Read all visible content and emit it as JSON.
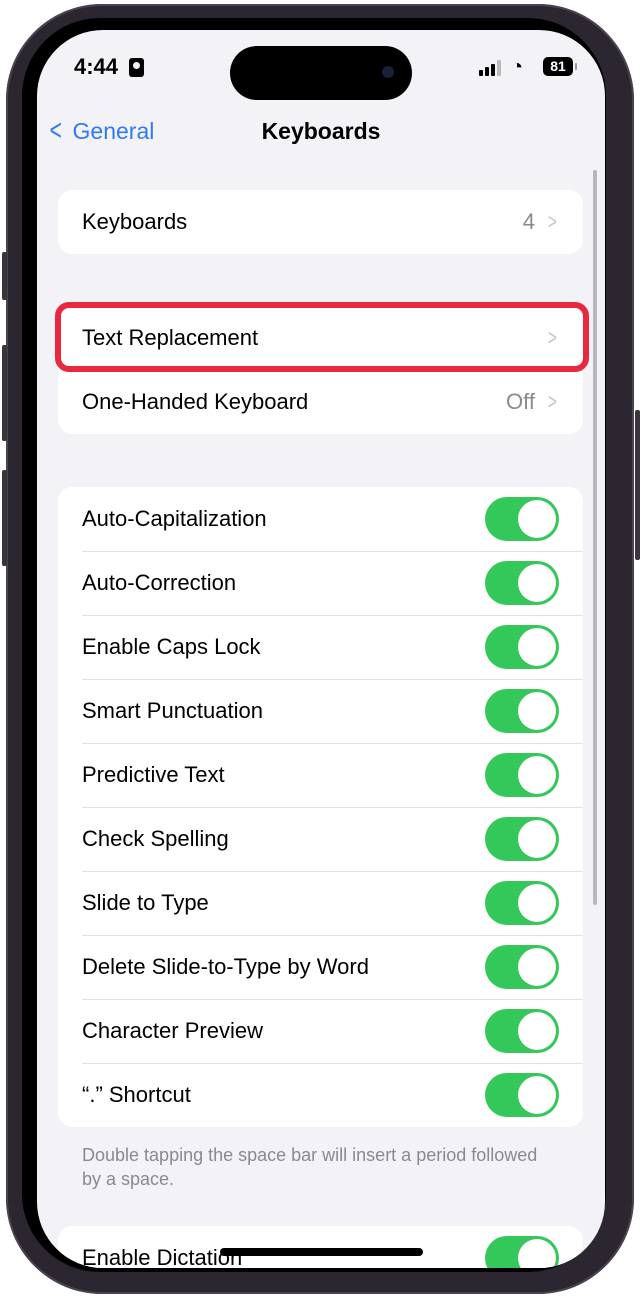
{
  "status_bar": {
    "time": "4:44",
    "battery": "81",
    "icons": [
      "person-card-icon",
      "signal-icon",
      "wifi-icon",
      "battery-icon"
    ]
  },
  "nav": {
    "back_label": "General",
    "title": "Keyboards"
  },
  "group1": [
    {
      "label": "Keyboards",
      "value": "4"
    }
  ],
  "group2": [
    {
      "label": "Text Replacement",
      "value": ""
    },
    {
      "label": "One-Handed Keyboard",
      "value": "Off"
    }
  ],
  "toggles": [
    {
      "label": "Auto-Capitalization",
      "on": true
    },
    {
      "label": "Auto-Correction",
      "on": true
    },
    {
      "label": "Enable Caps Lock",
      "on": true
    },
    {
      "label": "Smart Punctuation",
      "on": true
    },
    {
      "label": "Predictive Text",
      "on": true
    },
    {
      "label": "Check Spelling",
      "on": true
    },
    {
      "label": "Slide to Type",
      "on": true
    },
    {
      "label": "Delete Slide-to-Type by Word",
      "on": true
    },
    {
      "label": "Character Preview",
      "on": true
    },
    {
      "label": "“.” Shortcut",
      "on": true
    }
  ],
  "footnote": "Double tapping the space bar will insert a period followed by a space.",
  "group4": [
    {
      "label": "Enable Dictation",
      "on": true
    }
  ],
  "colors": {
    "accent": "#2f7bf5",
    "toggle_on": "#34c759",
    "highlight": "#e8283f"
  }
}
